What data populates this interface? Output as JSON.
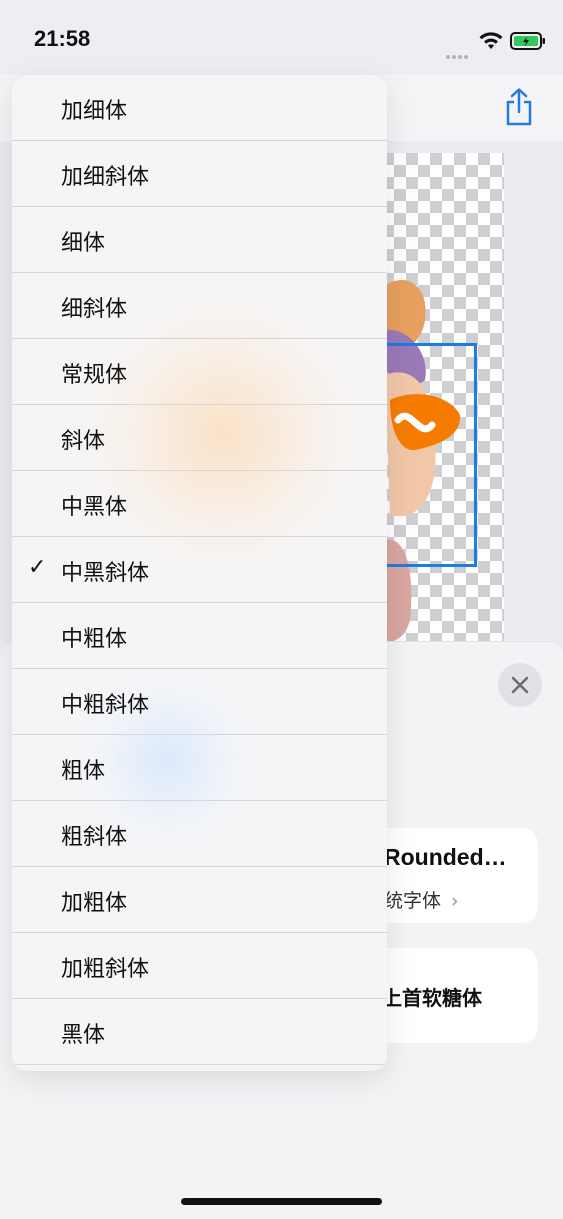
{
  "status_bar": {
    "time": "21:58"
  },
  "icons": {
    "share": "share-icon",
    "close": "close-icon",
    "check": "checkmark-icon",
    "chevron": "chevron-right-icon"
  },
  "colors": {
    "accent": "#1f7ce0",
    "battery": "#34c759"
  },
  "font_cards": [
    {
      "title": "Rounded…",
      "subtitle": "统字体",
      "chevron": "›"
    },
    {
      "title": "上首软糖体"
    }
  ],
  "weight_menu": {
    "selected": "中黑斜体",
    "items": [
      {
        "label": "加细体",
        "checked": false
      },
      {
        "label": "加细斜体",
        "checked": false
      },
      {
        "label": "细体",
        "checked": false
      },
      {
        "label": "细斜体",
        "checked": false
      },
      {
        "label": "常规体",
        "checked": false
      },
      {
        "label": "斜体",
        "checked": false
      },
      {
        "label": "中黑体",
        "checked": false
      },
      {
        "label": "中黑斜体",
        "checked": true,
        "check": "✓"
      },
      {
        "label": "中粗体",
        "checked": false
      },
      {
        "label": "中粗斜体",
        "checked": false
      },
      {
        "label": "粗体",
        "checked": false
      },
      {
        "label": "粗斜体",
        "checked": false
      },
      {
        "label": "加粗体",
        "checked": false
      },
      {
        "label": "加粗斜体",
        "checked": false
      },
      {
        "label": "黑体",
        "checked": false
      }
    ]
  }
}
